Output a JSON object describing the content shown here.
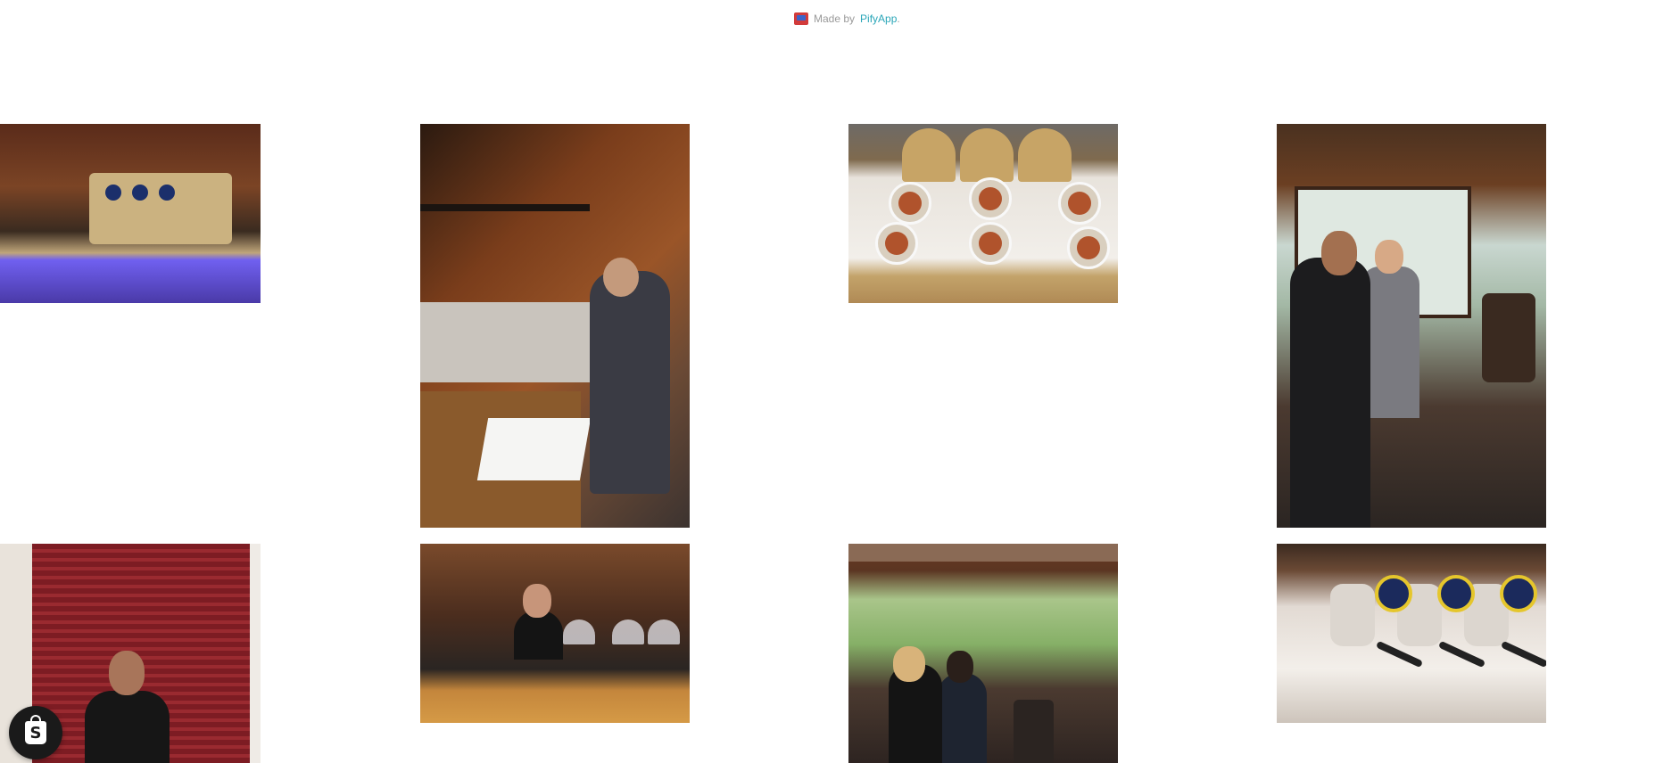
{
  "credit": {
    "prefix": "Made by",
    "link_text": "PifyApp",
    "suffix": "."
  },
  "gallery": {
    "photos": [
      {
        "name": "espresso-machine-photo"
      },
      {
        "name": "man-at-espresso-bar-photo"
      },
      {
        "name": "food-table-photo"
      },
      {
        "name": "two-men-coffee-bar-photo"
      },
      {
        "name": "man-red-shutter-photo"
      },
      {
        "name": "barista-counter-photo"
      },
      {
        "name": "two-women-espresso-bar-photo"
      },
      {
        "name": "espresso-machine-closeup-photo"
      }
    ]
  },
  "shop_button": {
    "glyph": "S",
    "icon": "shopify-bag-icon"
  }
}
